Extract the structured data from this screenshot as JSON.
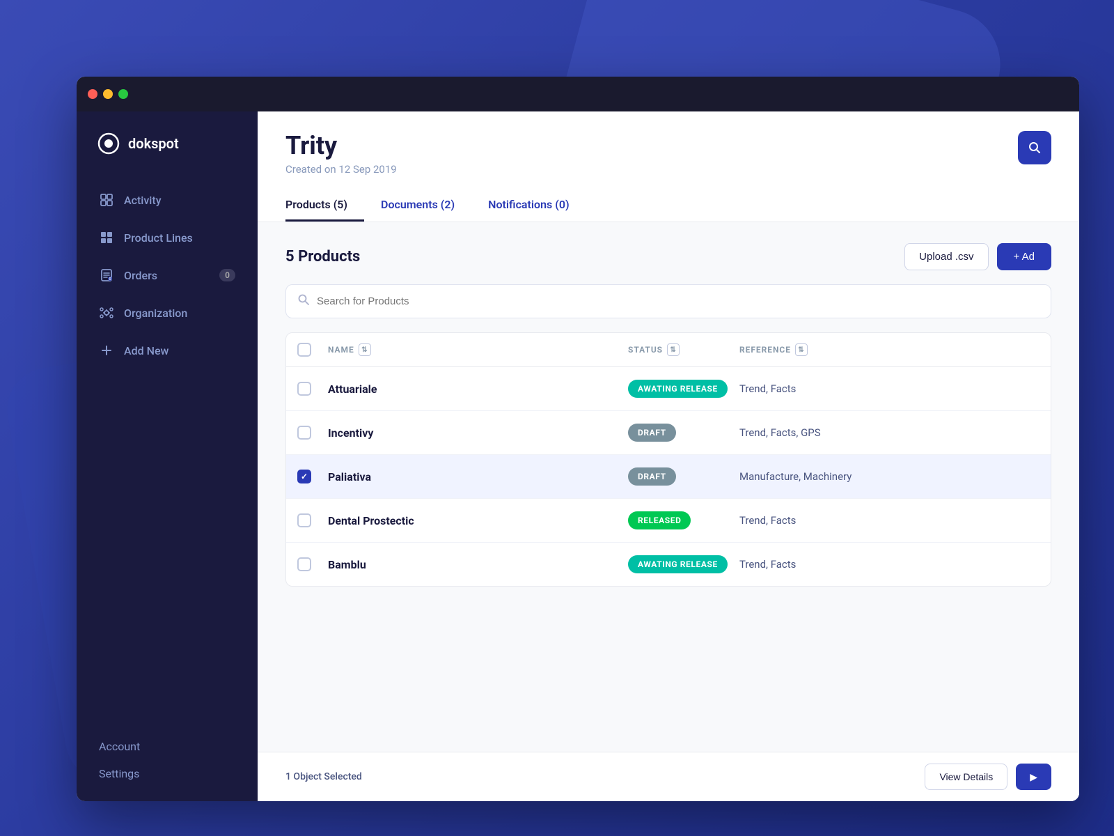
{
  "window": {
    "title": "dokspot"
  },
  "logo": {
    "text": "dokspot"
  },
  "sidebar": {
    "nav_items": [
      {
        "id": "activity",
        "label": "Activity",
        "icon": "activity"
      },
      {
        "id": "product-lines",
        "label": "Product Lines",
        "icon": "grid"
      },
      {
        "id": "orders",
        "label": "Orders",
        "icon": "orders",
        "badge": "0"
      },
      {
        "id": "organization",
        "label": "Organization",
        "icon": "org"
      },
      {
        "id": "add-new",
        "label": "Add New",
        "icon": "plus"
      }
    ],
    "bottom_items": [
      {
        "id": "account",
        "label": "Account"
      },
      {
        "id": "settings",
        "label": "Settings"
      }
    ]
  },
  "header": {
    "title": "Trity",
    "subtitle": "Created on 12 Sep 2019",
    "search_button_label": "🔍"
  },
  "tabs": [
    {
      "id": "products",
      "label": "Products (5)",
      "active": true
    },
    {
      "id": "documents",
      "label": "Documents (2)",
      "active": false
    },
    {
      "id": "notifications",
      "label": "Notifications (0)",
      "active": false
    }
  ],
  "content": {
    "products_count_label": "5 Products",
    "upload_csv_label": "Upload .csv",
    "add_button_label": "+ Ad",
    "search_placeholder": "Search for Products",
    "table": {
      "columns": [
        {
          "id": "name",
          "label": "NAME"
        },
        {
          "id": "status",
          "label": "STATUS"
        },
        {
          "id": "reference",
          "label": "REFERENCE"
        }
      ],
      "rows": [
        {
          "id": 1,
          "name": "Attuariale",
          "status": "AWATING RELEASE",
          "status_type": "awaiting",
          "reference": "Trend,  Facts",
          "selected": false
        },
        {
          "id": 2,
          "name": "Incentivy",
          "status": "DRAFT",
          "status_type": "draft",
          "reference": "Trend, Facts, GPS",
          "selected": false
        },
        {
          "id": 3,
          "name": "Paliativa",
          "status": "DRAFT",
          "status_type": "draft",
          "reference": "Manufacture, Machinery",
          "selected": true
        },
        {
          "id": 4,
          "name": "Dental Prostectic",
          "status": "RELEASED",
          "status_type": "released",
          "reference": "Trend,  Facts",
          "selected": false
        },
        {
          "id": 5,
          "name": "Bamblu",
          "status": "AWATING RELEASE",
          "status_type": "awaiting",
          "reference": "Trend,  Facts",
          "selected": false
        }
      ]
    }
  },
  "footer": {
    "selected_label": "1 Object Selected",
    "view_details_label": "View Details",
    "action_label": "▶"
  }
}
